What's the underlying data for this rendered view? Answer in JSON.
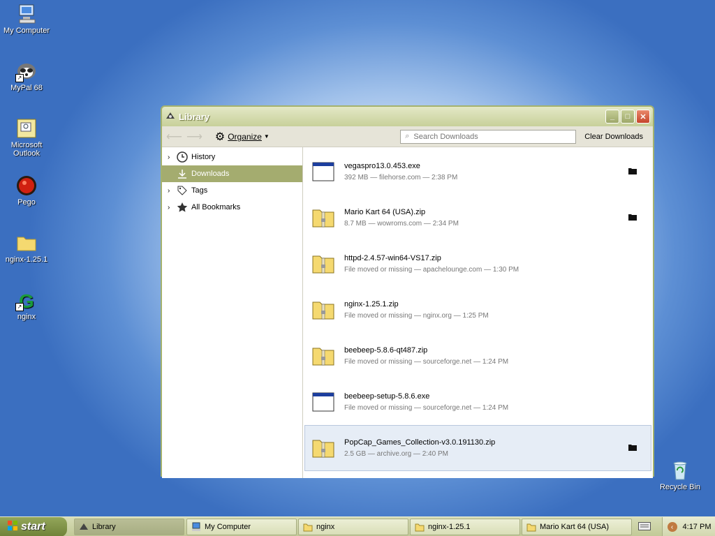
{
  "desktop": {
    "icons": [
      {
        "label": "My Computer",
        "icon": "computer-icon"
      },
      {
        "label": "MyPal 68",
        "icon": "mypal-icon"
      },
      {
        "label": "Microsoft Outlook",
        "icon": "outlook-icon"
      },
      {
        "label": "Pego",
        "icon": "pego-icon"
      },
      {
        "label": "nginx-1.25.1",
        "icon": "folder-icon"
      },
      {
        "label": "nginx",
        "icon": "nginx-icon"
      },
      {
        "label": "Recycle Bin",
        "icon": "recycle-bin-icon"
      }
    ]
  },
  "window": {
    "title": "Library",
    "toolbar": {
      "organize_label": "Organize",
      "search_placeholder": "Search Downloads",
      "clear_label": "Clear Downloads"
    },
    "sidebar": [
      {
        "label": "History",
        "icon": "clock-icon",
        "expandable": true
      },
      {
        "label": "Downloads",
        "icon": "download-icon",
        "expandable": false,
        "active": true
      },
      {
        "label": "Tags",
        "icon": "tag-icon",
        "expandable": true
      },
      {
        "label": "All Bookmarks",
        "icon": "star-icon",
        "expandable": true
      }
    ],
    "downloads": [
      {
        "name": "vegaspro13.0.453.exe",
        "status": "392 MB — filehorse.com — 2:38 PM",
        "type": "exe",
        "folder": true
      },
      {
        "name": "Mario Kart 64 (USA).zip",
        "status": "8.7 MB — wowroms.com — 2:34 PM",
        "type": "zip",
        "folder": true
      },
      {
        "name": "httpd-2.4.57-win64-VS17.zip",
        "status": "File moved or missing — apachelounge.com — 1:30 PM",
        "type": "zip",
        "folder": false
      },
      {
        "name": "nginx-1.25.1.zip",
        "status": "File moved or missing — nginx.org — 1:25 PM",
        "type": "zip",
        "folder": false
      },
      {
        "name": "beebeep-5.8.6-qt487.zip",
        "status": "File moved or missing — sourceforge.net — 1:24 PM",
        "type": "zip",
        "folder": false
      },
      {
        "name": "beebeep-setup-5.8.6.exe",
        "status": "File moved or missing — sourceforge.net — 1:24 PM",
        "type": "exe",
        "folder": false
      },
      {
        "name": "PopCap_Games_Collection-v3.0.191130.zip",
        "status": "2.5 GB — archive.org — 2:40 PM",
        "type": "zip",
        "folder": true,
        "selected": true
      }
    ]
  },
  "taskbar": {
    "start_label": "start",
    "tasks": [
      {
        "label": "Library",
        "active": true
      },
      {
        "label": "My Computer"
      },
      {
        "label": "nginx"
      },
      {
        "label": "nginx-1.25.1"
      },
      {
        "label": "Mario Kart 64 (USA)"
      }
    ],
    "clock": "4:17 PM"
  }
}
